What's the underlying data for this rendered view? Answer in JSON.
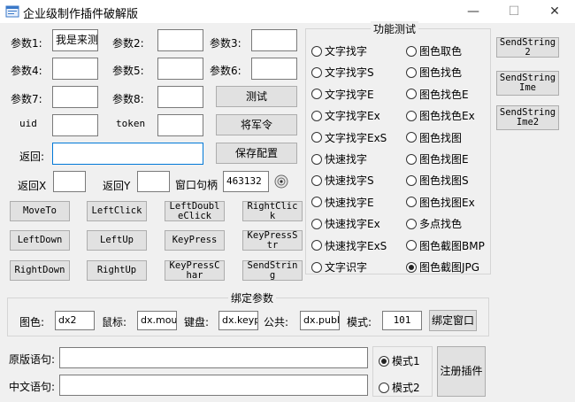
{
  "window": {
    "title": "企业级制作插件破解版",
    "minimize": "—",
    "maximize": "☐",
    "close": "✕"
  },
  "params": {
    "p1_label": "参数1:",
    "p1_value": "我是来测",
    "p2_label": "参数2:",
    "p2_value": "",
    "p3_label": "参数3:",
    "p3_value": "",
    "p4_label": "参数4:",
    "p4_value": "",
    "p5_label": "参数5:",
    "p5_value": "",
    "p6_label": "参数6:",
    "p6_value": "",
    "p7_label": "参数7:",
    "p7_value": "",
    "p8_label": "参数8:",
    "p8_value": "",
    "uid_label": "uid",
    "uid_value": "",
    "token_label": "token",
    "token_value": "",
    "return_label": "返回:",
    "return_value": "",
    "retx_label": "返回X",
    "retx_value": "",
    "rety_label": "返回Y",
    "rety_value": "",
    "hwnd_label": "窗口句柄",
    "hwnd_value": "463132"
  },
  "side_buttons": {
    "test": "测试",
    "general": "将军令",
    "save": "保存配置"
  },
  "action_buttons": [
    "MoveTo",
    "LeftClick",
    "LeftDoubleClick",
    "RightClick",
    "LeftDown",
    "LeftUp",
    "KeyPress",
    "KeyPressStr",
    "RightDown",
    "RightUp",
    "KeyPressChar",
    "SendString"
  ],
  "func_group": {
    "title": "功能测试",
    "left": [
      "文字找字",
      "文字找字S",
      "文字找字E",
      "文字找字Ex",
      "文字找字ExS",
      "快速找字",
      "快速找字S",
      "快速找字E",
      "快速找字Ex",
      "快速找字ExS",
      "文字识字"
    ],
    "right": [
      "图色取色",
      "图色找色",
      "图色找色E",
      "图色找色Ex",
      "图色找图",
      "图色找图E",
      "图色找图S",
      "图色找图Ex",
      "多点找色",
      "图色截图BMP",
      "图色截图JPG"
    ],
    "selected": "图色截图JPG"
  },
  "send_buttons": [
    "SendString2",
    "SendStringIme",
    "SendStringIme2"
  ],
  "bind_group": {
    "title": "绑定参数",
    "display_label": "图色:",
    "display_value": "dx2",
    "mouse_label": "鼠标:",
    "mouse_value": "dx.mous",
    "keypad_label": "键盘:",
    "keypad_value": "dx.keyp",
    "public_label": "公共:",
    "public_value": "dx.publ",
    "mode_label": "模式:",
    "mode_value": "101",
    "bind_button": "绑定窗口"
  },
  "bottom": {
    "orig_label": "原版语句:",
    "orig_value": "",
    "cn_label": "中文语句:",
    "cn_value": "",
    "mode1": "模式1",
    "mode2": "模式2",
    "selected_mode": "模式1",
    "register": "注册插件"
  }
}
